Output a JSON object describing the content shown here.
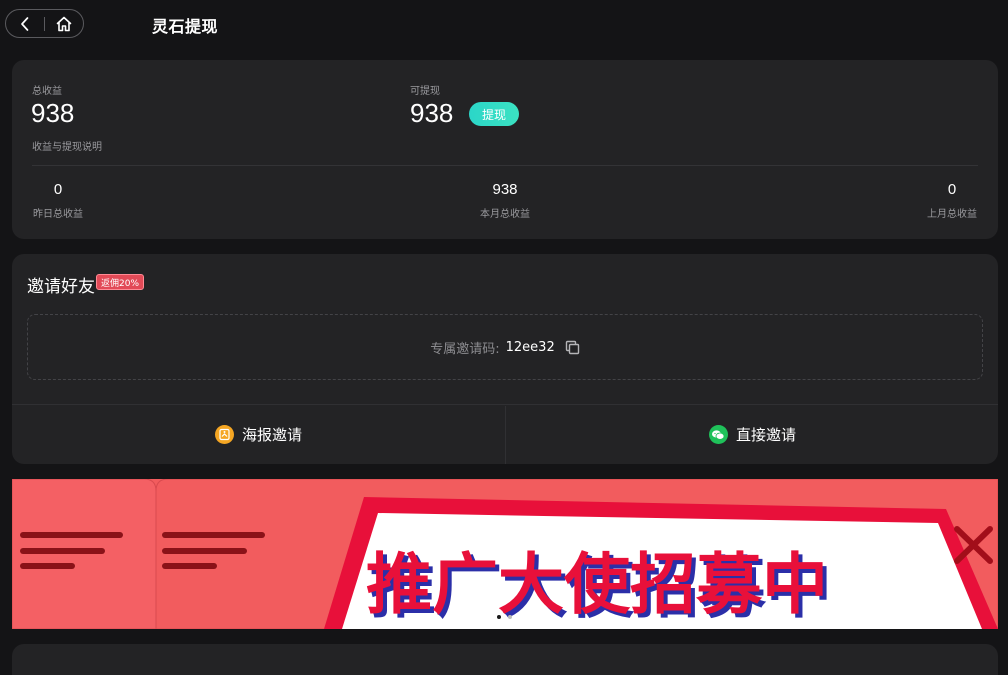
{
  "header": {
    "title": "灵石提现",
    "back_icon": "chevron-left-icon",
    "home_icon": "home-icon"
  },
  "earnings": {
    "total_label": "总收益",
    "total_value": "938",
    "explain_link": "收益与提现说明",
    "available_label": "可提现",
    "available_value": "938",
    "withdraw_label": "提现",
    "stats": [
      {
        "value": "0",
        "label": "昨日总收益"
      },
      {
        "value": "938",
        "label": "本月总收益"
      },
      {
        "value": "0",
        "label": "上月总收益"
      }
    ]
  },
  "invite": {
    "title": "邀请好友",
    "badge": "返佣20%",
    "code_label": "专属邀请码:",
    "code_value": "12ee32",
    "poster_label": "海报邀请",
    "direct_label": "直接邀请"
  },
  "banner": {
    "headline": "推广大使招募中",
    "slide_count": 2,
    "active_slide": 1
  },
  "colors": {
    "background": "#141416",
    "card": "#232325",
    "accent_teal": "#2bd6c8",
    "badge_red": "#e24a57",
    "poster_orange": "#f5a623",
    "wechat_green": "#1fc15a",
    "banner_red": "#f25c5e",
    "banner_headline": "#e8103a"
  }
}
